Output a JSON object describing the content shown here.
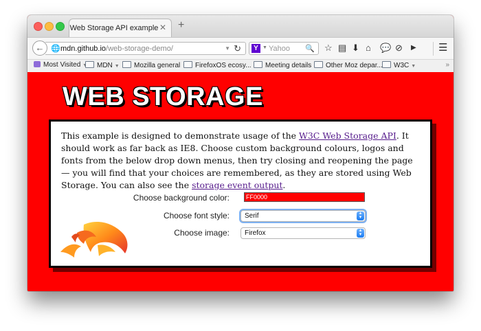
{
  "browser": {
    "tab_title": "Web Storage API example",
    "tab_close": "✕",
    "new_tab": "+",
    "url_host": "mdn.github.io",
    "url_path": "/web-storage-demo/",
    "search_engine_letter": "Y",
    "search_placeholder": "Yahoo"
  },
  "bookmarks": [
    {
      "label": "Most Visited",
      "icon": "most-visited-icon"
    },
    {
      "label": "MDN",
      "icon": "folder-icon"
    },
    {
      "label": "Mozilla general",
      "icon": "folder-icon"
    },
    {
      "label": "FirefoxOS ecosy...",
      "icon": "folder-icon"
    },
    {
      "label": "Meeting details",
      "icon": "folder-icon"
    },
    {
      "label": "Other Moz depar...",
      "icon": "folder-icon"
    },
    {
      "label": "W3C",
      "icon": "folder-icon"
    }
  ],
  "page": {
    "heading": "WEB STORAGE",
    "intro_part1": "This example is designed to demonstrate usage of the ",
    "intro_link1": "W3C Web Storage API",
    "intro_part2": ". It should work as far back as IE8. Choose custom background colours, logos and fonts from the below drop down menus, then try closing and reopening the page — you will find that your choices are remembered, as they are stored using Web Storage. You can also see the ",
    "intro_link2": "storage event output",
    "intro_part3": ".",
    "background_label": "Choose background color:",
    "background_value": "FF0000",
    "font_label": "Choose font style:",
    "font_value": "Serif",
    "image_label": "Choose image:",
    "image_value": "Firefox"
  },
  "colors": {
    "page_background": "#ff0000",
    "link": "#551a8b",
    "select_button": "#1b7cf2"
  }
}
